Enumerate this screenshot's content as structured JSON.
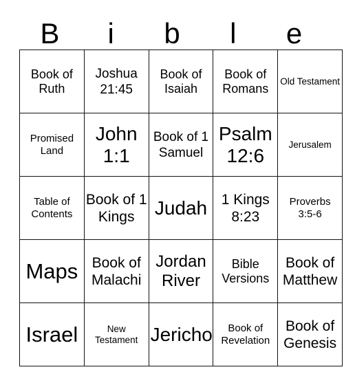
{
  "card": {
    "title_letters": [
      "B",
      "i",
      "b",
      "l",
      "e"
    ],
    "columns": 5,
    "rows": 5,
    "colors": {
      "background": "#ffffff",
      "text": "#000000",
      "grid_line": "#111111",
      "outer_border": "#4d4d4d"
    },
    "cells": [
      [
        {
          "text": "Book of Ruth",
          "size": "m"
        },
        {
          "text": "Joshua 21:45",
          "size": "ml"
        },
        {
          "text": "Book of Isaiah",
          "size": "m"
        },
        {
          "text": "Book of Romans",
          "size": "m"
        },
        {
          "text": "Old Testament",
          "size": "xs"
        }
      ],
      [
        {
          "text": "Promised Land",
          "size": "s"
        },
        {
          "text": "John 1:1",
          "size": "xxl"
        },
        {
          "text": "Book of 1 Samuel",
          "size": "ml"
        },
        {
          "text": "Psalm 12:6",
          "size": "xxl"
        },
        {
          "text": "Jerusalem",
          "size": "xs"
        }
      ],
      [
        {
          "text": "Table of Contents",
          "size": "s"
        },
        {
          "text": "Book of 1 Kings",
          "size": "l"
        },
        {
          "text": "Judah",
          "size": "xxl"
        },
        {
          "text": "1 Kings 8:23",
          "size": "l"
        },
        {
          "text": "Proverbs 3:5-6",
          "size": "s"
        }
      ],
      [
        {
          "text": "Maps",
          "size": "huge"
        },
        {
          "text": "Book of Malachi",
          "size": "l"
        },
        {
          "text": "Jordan River",
          "size": "xl"
        },
        {
          "text": "Bible Versions",
          "size": "m"
        },
        {
          "text": "Book of Matthew",
          "size": "l"
        }
      ],
      [
        {
          "text": "Israel",
          "size": "huge"
        },
        {
          "text": "New Testament",
          "size": "xs"
        },
        {
          "text": "Jericho",
          "size": "xxl"
        },
        {
          "text": "Book of Revelation",
          "size": "s"
        },
        {
          "text": "Book of Genesis",
          "size": "l"
        }
      ]
    ]
  }
}
